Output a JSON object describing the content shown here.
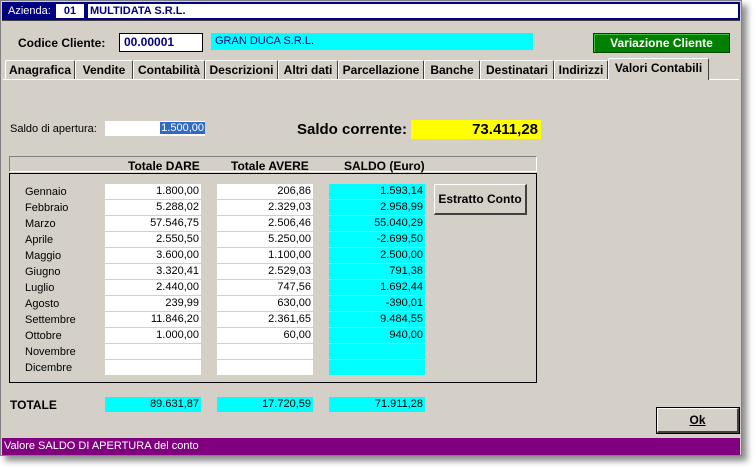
{
  "azienda": {
    "label": "Azienda:",
    "code": "01",
    "name": "MULTIDATA S.R.L."
  },
  "cliente": {
    "label": "Codice Cliente:",
    "code": "00.00001",
    "name": "GRAN DUCA S.R.L."
  },
  "buttons": {
    "variazione": "Variazione Cliente",
    "estratto": "Estratto Conto",
    "ok": "Ok"
  },
  "tabs": [
    {
      "label": "Anagrafica"
    },
    {
      "label": "Vendite"
    },
    {
      "label": "Contabilità"
    },
    {
      "label": "Descrizioni"
    },
    {
      "label": "Altri dati"
    },
    {
      "label": "Parcellazione"
    },
    {
      "label": "Banche"
    },
    {
      "label": "Destinatari"
    },
    {
      "label": "Indirizzi"
    },
    {
      "label": "Valori Contabili"
    }
  ],
  "saldo_apertura": {
    "label": "Saldo di apertura:",
    "value": "1.500,00"
  },
  "saldo_corrente": {
    "label": "Saldo corrente:",
    "value": "73.411,28"
  },
  "columns": {
    "dare": "Totale DARE",
    "avere": "Totale AVERE",
    "saldo": "SALDO (Euro)"
  },
  "months": [
    {
      "name": "Gennaio",
      "dare": "1.800,00",
      "avere": "206,86",
      "saldo": "1.593,14"
    },
    {
      "name": "Febbraio",
      "dare": "5.288,02",
      "avere": "2.329,03",
      "saldo": "2.958,99"
    },
    {
      "name": "Marzo",
      "dare": "57.546,75",
      "avere": "2.506,46",
      "saldo": "55.040,29"
    },
    {
      "name": "Aprile",
      "dare": "2.550,50",
      "avere": "5.250,00",
      "saldo": "-2.699,50"
    },
    {
      "name": "Maggio",
      "dare": "3.600,00",
      "avere": "1.100,00",
      "saldo": "2.500,00"
    },
    {
      "name": "Giugno",
      "dare": "3.320,41",
      "avere": "2.529,03",
      "saldo": "791,38"
    },
    {
      "name": "Luglio",
      "dare": "2.440,00",
      "avere": "747,56",
      "saldo": "1.692,44"
    },
    {
      "name": "Agosto",
      "dare": "239,99",
      "avere": "630,00",
      "saldo": "-390,01"
    },
    {
      "name": "Settembre",
      "dare": "11.846,20",
      "avere": "2.361,65",
      "saldo": "9.484,55"
    },
    {
      "name": "Ottobre",
      "dare": "1.000,00",
      "avere": "60,00",
      "saldo": "940,00"
    },
    {
      "name": "Novembre",
      "dare": "",
      "avere": "",
      "saldo": ""
    },
    {
      "name": "Dicembre",
      "dare": "",
      "avere": "",
      "saldo": ""
    }
  ],
  "totale": {
    "label": "TOTALE",
    "dare": "89.631,87",
    "avere": "17.720,59",
    "saldo": "71.911,28"
  },
  "status": "Valore SALDO DI APERTURA del conto"
}
